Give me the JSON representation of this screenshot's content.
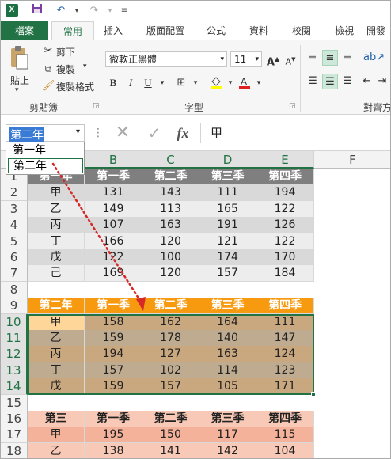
{
  "titlebar": {
    "logo": "X",
    "icons": [
      "save-icon",
      "undo-icon",
      "redo-icon",
      "customize-qat-icon"
    ]
  },
  "tabs": [
    "檔案",
    "常用",
    "插入",
    "版面配置",
    "公式",
    "資料",
    "校閱",
    "檢視",
    "開發"
  ],
  "active_tab": "常用",
  "clipboard": {
    "paste": "貼上",
    "cut": "剪下",
    "copy": "複製",
    "format_painter": "複製格式",
    "group": "剪貼簿"
  },
  "font": {
    "name": "微軟正黑體",
    "size": "11",
    "group": "字型"
  },
  "alignment": {
    "group": "對齊方"
  },
  "formula_bar": {
    "name_box": "第二年",
    "fx": "fx",
    "content": "甲"
  },
  "name_box_dropdown": [
    "第一年",
    "第二年"
  ],
  "columns": [
    "A",
    "B",
    "C",
    "D",
    "E",
    "F"
  ],
  "selected_columns": [
    "A",
    "B",
    "C",
    "D",
    "E"
  ],
  "rows": [
    "1",
    "2",
    "3",
    "4",
    "5",
    "6",
    "7",
    "8",
    "9",
    "10",
    "11",
    "12",
    "13",
    "14",
    "15",
    "16",
    "17",
    "18"
  ],
  "selected_rows": [
    "10",
    "11",
    "12",
    "13",
    "14"
  ],
  "table1": {
    "headers": [
      "第一年",
      "第一季",
      "第二季",
      "第三季",
      "第四季"
    ],
    "rows": [
      [
        "甲",
        "131",
        "143",
        "111",
        "194"
      ],
      [
        "乙",
        "149",
        "113",
        "165",
        "122"
      ],
      [
        "丙",
        "107",
        "163",
        "191",
        "126"
      ],
      [
        "丁",
        "166",
        "120",
        "121",
        "122"
      ],
      [
        "戊",
        "122",
        "100",
        "174",
        "170"
      ],
      [
        "己",
        "169",
        "120",
        "157",
        "184"
      ]
    ]
  },
  "table2": {
    "headers": [
      "第二年",
      "第一季",
      "第二季",
      "第三季",
      "第四季"
    ],
    "rows": [
      [
        "甲",
        "158",
        "162",
        "164",
        "111"
      ],
      [
        "乙",
        "159",
        "178",
        "140",
        "147"
      ],
      [
        "丙",
        "194",
        "127",
        "163",
        "124"
      ],
      [
        "丁",
        "157",
        "102",
        "114",
        "123"
      ],
      [
        "戊",
        "159",
        "157",
        "105",
        "171"
      ]
    ]
  },
  "table3": {
    "headers": [
      "第三",
      "第一季",
      "第二季",
      "第三季",
      "第四季"
    ],
    "rows": [
      [
        "甲",
        "195",
        "150",
        "117",
        "115"
      ],
      [
        "乙",
        "138",
        "141",
        "142",
        "104"
      ]
    ]
  },
  "colors": {
    "excel_green": "#217346",
    "t1_header": "#7f7f7f",
    "t1_row": "#d9d9d9",
    "t1_row_alt": "#ededed",
    "t2_header": "#f79a0f",
    "t2_row": "#c9a77f",
    "t2_row_alt": "#bfab90",
    "t2_active": "#ffd699",
    "t3_header": "#f8c9b6",
    "t3_row": "#f4b29a",
    "arrow": "#d62828"
  }
}
